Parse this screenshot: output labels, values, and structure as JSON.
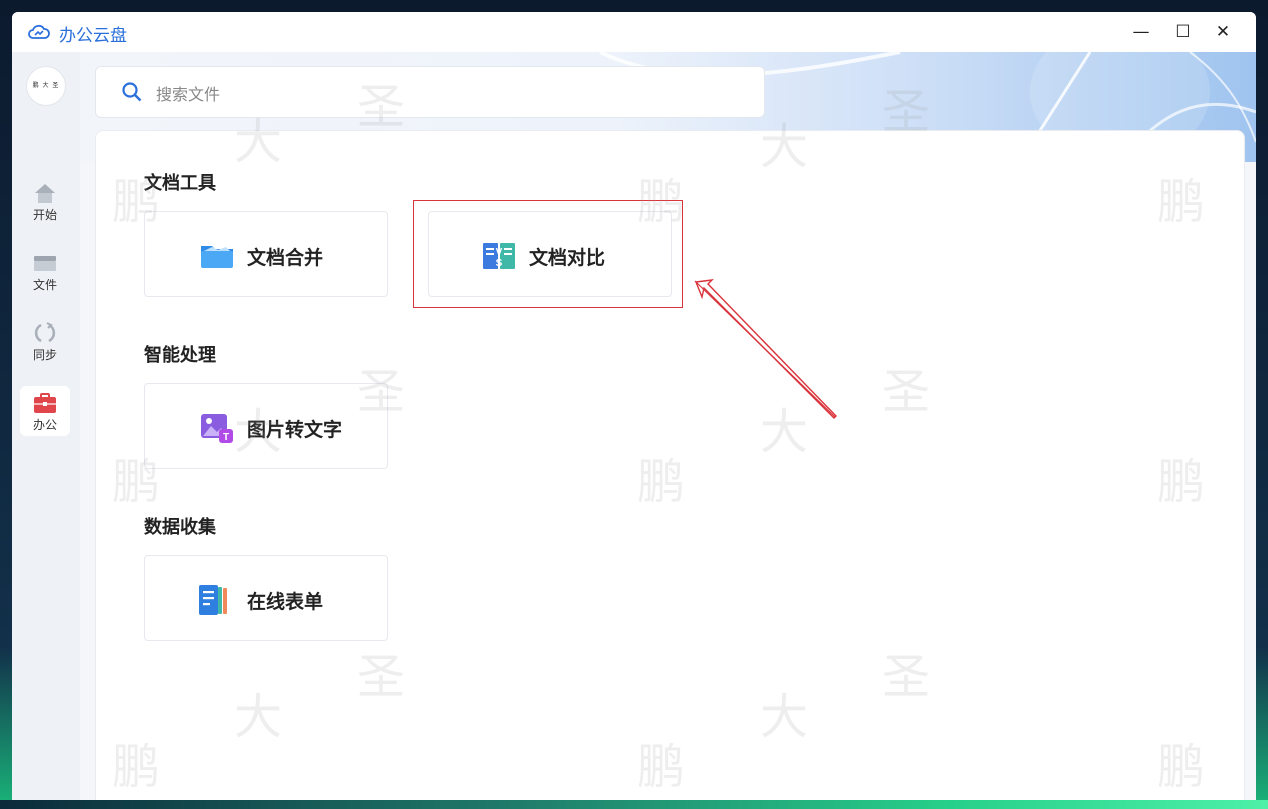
{
  "window": {
    "title": "办公云盘",
    "controls": {
      "minimize": "—",
      "maximize": "☐",
      "close": "✕"
    }
  },
  "sidebar": {
    "avatar_text": "鹏 大 圣",
    "items": [
      {
        "label": "开始",
        "icon": "home-icon"
      },
      {
        "label": "文件",
        "icon": "folder-icon"
      },
      {
        "label": "同步",
        "icon": "sync-icon"
      },
      {
        "label": "办公",
        "icon": "briefcase-icon",
        "active": true
      }
    ]
  },
  "search": {
    "placeholder": "搜索文件"
  },
  "sections": [
    {
      "title": "文档工具",
      "cards": [
        {
          "label": "文档合并",
          "icon": "folder-merge-icon"
        },
        {
          "label": "文档对比",
          "icon": "vs-compare-icon"
        }
      ]
    },
    {
      "title": "智能处理",
      "cards": [
        {
          "label": "图片转文字",
          "icon": "image-to-text-icon"
        }
      ]
    },
    {
      "title": "数据收集",
      "cards": [
        {
          "label": "在线表单",
          "icon": "online-form-icon"
        }
      ]
    }
  ],
  "watermark": {
    "chars": [
      "鹏",
      "大",
      "圣"
    ]
  },
  "colors": {
    "accent": "#2a6fdb",
    "annotation": "#d9333b",
    "active_nav": "#e0454b"
  }
}
